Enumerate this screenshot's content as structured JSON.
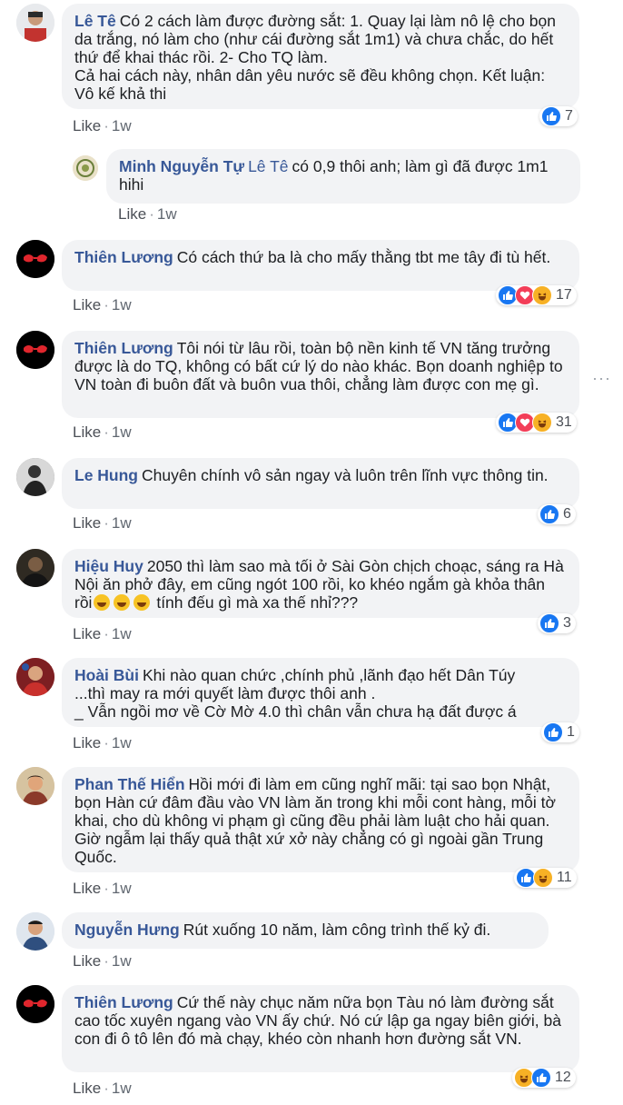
{
  "comments": [
    {
      "author": "Lê Tê",
      "text": "Có 2 cách làm được đường sắt: 1. Quay lại làm nô lệ cho bọn da trắng, nó làm cho (như cái đường sắt 1m1) và chưa chắc, do hết thứ để khai thác rồi. 2- Cho TQ làm.",
      "text2": "Cả hai cách này, nhân dân yêu nước sẽ đều không chọn. Kết luận: Vô kế khả thi",
      "like_label": "Like",
      "time": "1w",
      "reaction_count": "7"
    },
    {
      "author": "Minh Nguyễn Tự",
      "mention": "Lê Tê",
      "text": "có 0,9 thôi anh; làm gì đã được 1m1 hihi",
      "like_label": "Like",
      "time": "1w"
    },
    {
      "author": "Thiên Lương",
      "text": "Có cách thứ ba là cho mấy thằng tbt me tây đi tù hết.",
      "like_label": "Like",
      "time": "1w",
      "reaction_count": "17"
    },
    {
      "author": "Thiên Lương",
      "text": "Tôi nói từ lâu rồi, toàn bộ nền kinh tế VN tăng trưởng được là do TQ, không có bất cứ lý do nào khác. Bọn doanh nghiệp to VN toàn đi buôn đất và buôn vua thôi, chẳng làm được con mẹ gì.",
      "like_label": "Like",
      "time": "1w",
      "reaction_count": "31"
    },
    {
      "author": "Le Hung",
      "text": "Chuyên chính vô sản ngay và luôn trên lĩnh vực thông tin.",
      "like_label": "Like",
      "time": "1w",
      "reaction_count": "6"
    },
    {
      "author": "Hiệu Huy",
      "text": "2050 thì làm sao mà tối ở Sài Gòn chịch choạc, sáng ra Hà Nội ăn phở đây, em cũng ngót 100 rồi, ko khéo ngắm gà khỏa thân rồi",
      "text_after": "tính đếu gì mà xa thế nhỉ???",
      "like_label": "Like",
      "time": "1w",
      "reaction_count": "3"
    },
    {
      "author": "Hoài Bùi",
      "text": "Khi nào quan chức ,chính phủ ,lãnh đạo hết Dân Túy",
      "text2": "...thì may ra mới quyết làm được thôi anh .",
      "text3": "_ Vẫn ngồi mơ về Cờ Mờ 4.0 thì chân vẫn chưa hạ đất được á",
      "like_label": "Like",
      "time": "1w",
      "reaction_count": "1"
    },
    {
      "author": "Phan Thế Hiển",
      "text": "Hồi mới đi làm em cũng nghĩ mãi: tại sao bọn Nhật, bọn Hàn cứ đâm đầu vào VN làm ăn trong khi mỗi cont hàng, mỗi tờ khai, cho dù không vi phạm gì cũng đều phải làm luật cho hải quan. Giờ ngẫm lại thấy quả thật xứ xở này chẳng có gì ngoài gần Trung Quốc.",
      "like_label": "Like",
      "time": "1w",
      "reaction_count": "11"
    },
    {
      "author": "Nguyễn Hưng",
      "text": "Rút xuống 10 năm, làm công trình thế kỷ đi.",
      "like_label": "Like",
      "time": "1w"
    },
    {
      "author": "Thiên Lương",
      "text": "Cứ thế này chục năm nữa bọn Tàu nó làm đường sắt cao tốc xuyên ngang vào VN ấy chứ. Nó cứ lập ga ngay biên giới, bà con đi ô tô lên đó mà chạy, khéo còn nhanh hơn đường sắt VN.",
      "like_label": "Like",
      "time": "1w",
      "reaction_count": "12"
    }
  ],
  "more_options": "···",
  "colors": {
    "link": "#385898",
    "bubble": "#f2f3f5",
    "like": "#1877f2",
    "love": "#f33e58",
    "haha": "#f7b125"
  },
  "icons": [
    "like-reaction-icon",
    "love-reaction-icon",
    "haha-reaction-icon",
    "grinning-emoji-icon",
    "more-options-icon"
  ]
}
